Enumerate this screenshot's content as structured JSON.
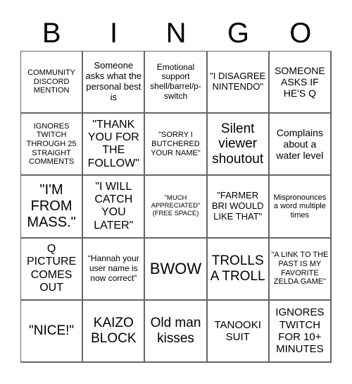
{
  "header": {
    "letters": [
      "B",
      "I",
      "N",
      "G",
      "O"
    ]
  },
  "cells": [
    [
      "COMMUNITY DISCORD MENTION",
      "Someone asks what the personal best is",
      "Emotional support shell/barrel/p-switch",
      "\"I DISAGREE NINTENDO\"",
      "SOMEONE ASKS IF HE'S Q"
    ],
    [
      "IGNORES TWITCH THROUGH 25 STRAIGHT COMMENTS",
      "\"THANK YOU FOR THE FOLLOW\"",
      "\"SORRY I BUTCHERED YOUR NAME\"",
      "Silent viewer shoutout",
      "Complains about a water level"
    ],
    [
      "\"I'M FROM MASS.\"",
      "\"I WILL CATCH YOU LATER\"",
      "\"MUCH APPRECIATED\" (FREE SPACE)",
      "\"FARMER BRI WOULD LIKE THAT\"",
      "Mispronounces a word multiple times"
    ],
    [
      "Q PICTURE COMES OUT",
      "“Hannah your user name is now correct”",
      "BWOW",
      "TROLLS A TROLL",
      "\"A LINK TO THE PAST IS MY FAVORITE ZELDA GAME\""
    ],
    [
      "\"NICE!\"",
      "KAIZO BLOCK",
      "Old man kisses",
      "TANOOKI SUIT",
      "IGNORES TWITCH FOR 10+ MINUTES"
    ]
  ]
}
